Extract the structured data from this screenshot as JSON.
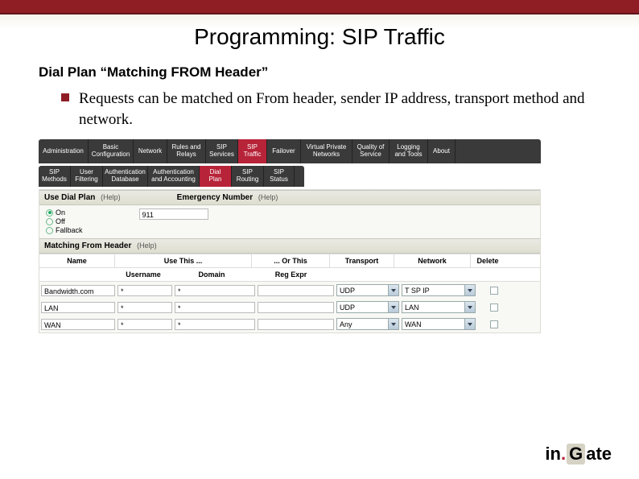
{
  "slide": {
    "title": "Programming: SIP Traffic",
    "heading": "Dial Plan  “Matching FROM Header”",
    "bullet": "Requests can be matched on From header, sender IP address, transport method and network."
  },
  "tabs1": [
    "Administration",
    "Basic Configuration",
    "Network",
    "Rules and Relays",
    "SIP Services",
    "SIP Traffic",
    "Failover",
    "Virtual Private Networks",
    "Quality of Service",
    "Logging and Tools",
    "About"
  ],
  "tabs1_active": 5,
  "tabs2": [
    "SIP Methods",
    "User Filtering",
    "Authentication Database",
    "Authentication and Accounting",
    "Dial Plan",
    "SIP Routing",
    "SIP Status"
  ],
  "tabs2_active": 4,
  "greybar": {
    "use_label": "Use Dial Plan",
    "emerg_label": "Emergency Number",
    "help": "(Help)"
  },
  "radios": {
    "on": "On",
    "off": "Off",
    "fallback": "Fallback"
  },
  "emerg_value": "911",
  "greybar2": {
    "label": "Matching From Header",
    "help": "(Help)"
  },
  "cols": {
    "name": "Name",
    "usethis": "Use This ...",
    "orthis": "... Or This",
    "transport": "Transport",
    "network": "Network",
    "delete": "Delete",
    "username": "Username",
    "domain": "Domain",
    "regexpr": "Reg Expr"
  },
  "rows": [
    {
      "name": "Bandwidth.com",
      "username": "*",
      "domain": "*",
      "regexpr": "",
      "transport": "UDP",
      "network": "T SP IP"
    },
    {
      "name": "LAN",
      "username": "*",
      "domain": "*",
      "regexpr": "",
      "transport": "UDP",
      "network": "LAN"
    },
    {
      "name": "WAN",
      "username": "*",
      "domain": "*",
      "regexpr": "",
      "transport": "Any",
      "network": "WAN"
    }
  ],
  "logo": {
    "in": "in",
    "dot": ".",
    "g": "G",
    "ate": "ate"
  }
}
